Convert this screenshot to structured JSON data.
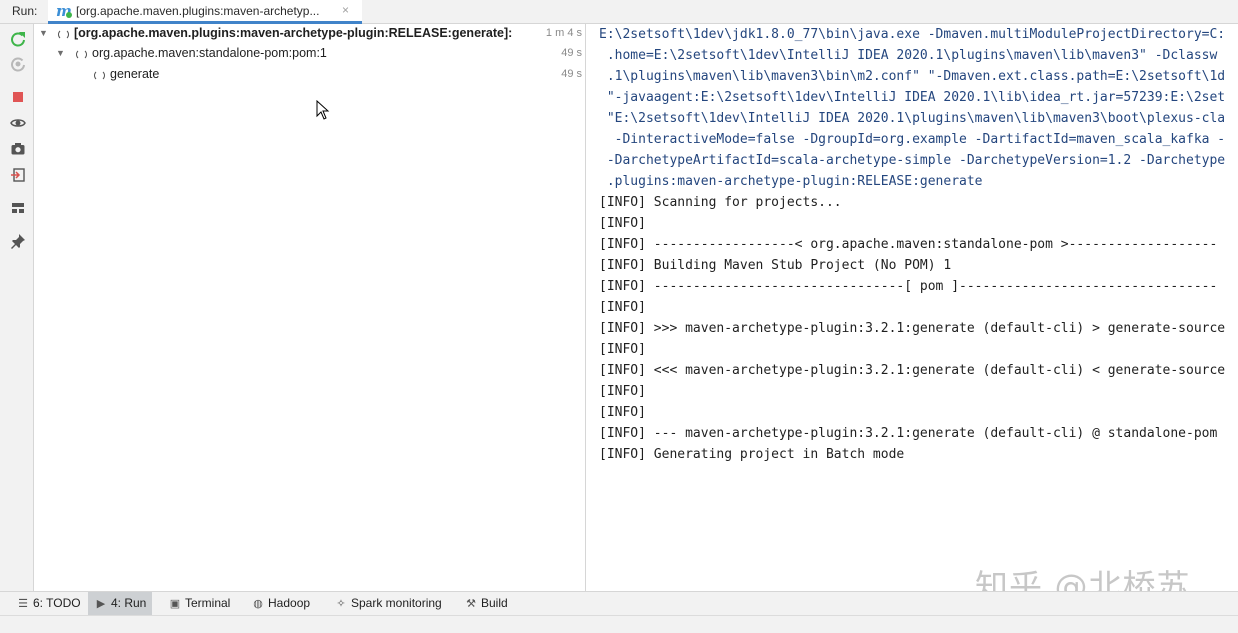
{
  "header": {
    "run_label": "Run:",
    "tab_title": "[org.apache.maven.plugins:maven-archetyp...",
    "close_glyph": "×"
  },
  "toolbar": {
    "icons": [
      "rerun-icon",
      "rerun-failed-icon",
      "stop-icon",
      "show-icon",
      "camera-icon",
      "export-icon",
      "layout-icon",
      "pin-icon"
    ]
  },
  "tree": {
    "rows": [
      {
        "label": "[org.apache.maven.plugins:maven-archetype-plugin:RELEASE:generate]:",
        "time": "1 m 4 s"
      },
      {
        "label": "org.apache.maven:standalone-pom:pom:1",
        "time": "49 s"
      },
      {
        "label": "generate",
        "time": "49 s"
      }
    ]
  },
  "console": {
    "lines": [
      "E:\\2setsoft\\1dev\\jdk1.8.0_77\\bin\\java.exe -Dmaven.multiModuleProjectDirectory=C:",
      " .home=E:\\2setsoft\\1dev\\IntelliJ IDEA 2020.1\\plugins\\maven\\lib\\maven3\" -Dclassw",
      " .1\\plugins\\maven\\lib\\maven3\\bin\\m2.conf\" \"-Dmaven.ext.class.path=E:\\2setsoft\\1d",
      " \"-javaagent:E:\\2setsoft\\1dev\\IntelliJ IDEA 2020.1\\lib\\idea_rt.jar=57239:E:\\2set",
      " \"E:\\2setsoft\\1dev\\IntelliJ IDEA 2020.1\\plugins\\maven\\lib\\maven3\\boot\\plexus-cla",
      "  -DinteractiveMode=false -DgroupId=org.example -DartifactId=maven_scala_kafka -",
      " -DarchetypeArtifactId=scala-archetype-simple -DarchetypeVersion=1.2 -Darchetype",
      " .plugins:maven-archetype-plugin:RELEASE:generate",
      "[INFO] Scanning for projects...",
      "[INFO]",
      "[INFO] ------------------< org.apache.maven:standalone-pom >-------------------",
      "[INFO] Building Maven Stub Project (No POM) 1",
      "[INFO] --------------------------------[ pom ]---------------------------------",
      "[INFO]",
      "[INFO] >>> maven-archetype-plugin:3.2.1:generate (default-cli) > generate-source",
      "[INFO]",
      "[INFO] <<< maven-archetype-plugin:3.2.1:generate (default-cli) < generate-source",
      "[INFO]",
      "[INFO]",
      "[INFO] --- maven-archetype-plugin:3.2.1:generate (default-cli) @ standalone-pom",
      "[INFO] Generating project in Batch mode"
    ],
    "watermark": "知乎 @北桥苏"
  },
  "bottombar": {
    "todo": "6: TODO",
    "run": "4: Run",
    "terminal": "Terminal",
    "hadoop": "Hadoop",
    "spark": "Spark monitoring",
    "build": "Build"
  },
  "colors": {
    "accent": "#4083c9",
    "stop": "#e05555",
    "rerun": "#3eb54a",
    "command_text": "#24467e"
  }
}
